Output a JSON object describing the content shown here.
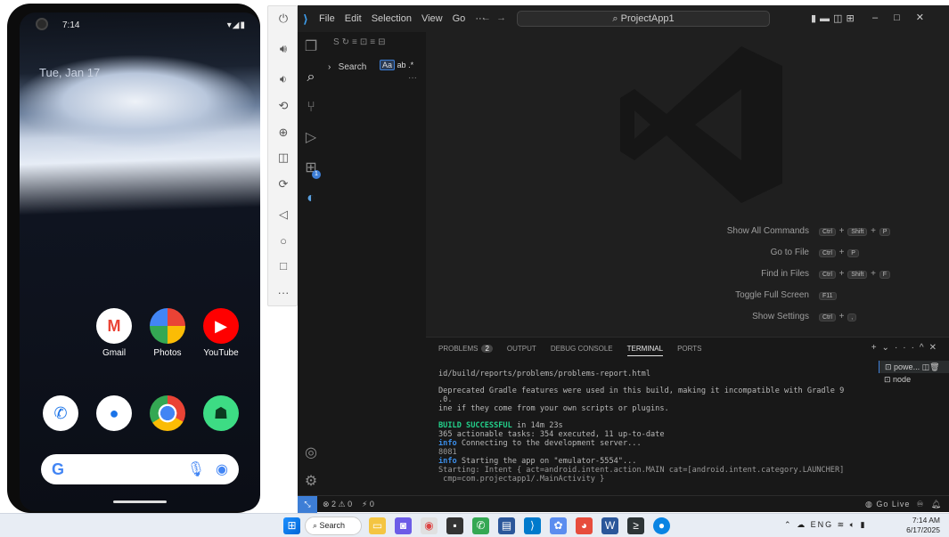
{
  "phone": {
    "status_time": "7:14",
    "date": "Tue, Jan 17",
    "apps_row1": [
      {
        "label": "Gmail",
        "icon": "gmail-icon"
      },
      {
        "label": "Photos",
        "icon": "photos-icon"
      },
      {
        "label": "YouTube",
        "icon": "youtube-icon"
      }
    ],
    "apps_dock": [
      {
        "icon": "phone-icon"
      },
      {
        "icon": "messages-icon"
      },
      {
        "icon": "chrome-icon"
      },
      {
        "icon": "android-icon"
      }
    ],
    "search_g": "G"
  },
  "vscode": {
    "menu": [
      "File",
      "Edit",
      "Selection",
      "View",
      "Go",
      "···"
    ],
    "search_title": "ProjectApp1",
    "sidebar": {
      "search_label": "Search",
      "match_case": "Aa"
    },
    "shortcuts": [
      {
        "label": "Show All Commands",
        "keys": [
          "Ctrl",
          "+",
          "Shift",
          "+",
          "P"
        ]
      },
      {
        "label": "Go to File",
        "keys": [
          "Ctrl",
          "+",
          "P"
        ]
      },
      {
        "label": "Find in Files",
        "keys": [
          "Ctrl",
          "+",
          "Shift",
          "+",
          "F"
        ]
      },
      {
        "label": "Toggle Full Screen",
        "keys": [
          "F11"
        ]
      },
      {
        "label": "Show Settings",
        "keys": [
          "Ctrl",
          "+",
          ","
        ]
      }
    ],
    "panel": {
      "tabs": [
        {
          "label": "PROBLEMS",
          "count": "2"
        },
        {
          "label": "OUTPUT"
        },
        {
          "label": "DEBUG CONSOLE"
        },
        {
          "label": "TERMINAL",
          "active": true
        },
        {
          "label": "PORTS"
        }
      ],
      "terminal_lines": [
        "id/build/reports/problems/problems-report.html",
        "",
        "Deprecated Gradle features were used in this build, making it incompatible with Gradle 9",
        ".0.",
        "ine if they come from your own scripts or plugins.",
        "",
        {
          "b": "BUILD SUCCESSFUL",
          "t": " in 14m 23s"
        },
        "365 actionable tasks: 354 executed, 11 up-to-date",
        {
          "i": "info",
          "t": " Connecting to the development server..."
        },
        {
          "g": "8081"
        },
        {
          "i": "info",
          "t": " Starting the app on \"emulator-5554\"..."
        },
        {
          "g": "Starting: Intent { act=android.intent.action.MAIN cat=[android.intent.category.LAUNCHER]"
        },
        {
          "g": " cmp=com.projectapp1/.MainActivity }"
        }
      ],
      "terminals": [
        "powe...",
        "node"
      ]
    },
    "statusbar": {
      "problems": "⊗ 2 ⚠ 0",
      "ports": "⚡ 0",
      "golive": "Go Live"
    }
  },
  "taskbar": {
    "search": "Search",
    "lang": "ENG",
    "time": "7:14 AM",
    "date": "6/17/2025"
  }
}
